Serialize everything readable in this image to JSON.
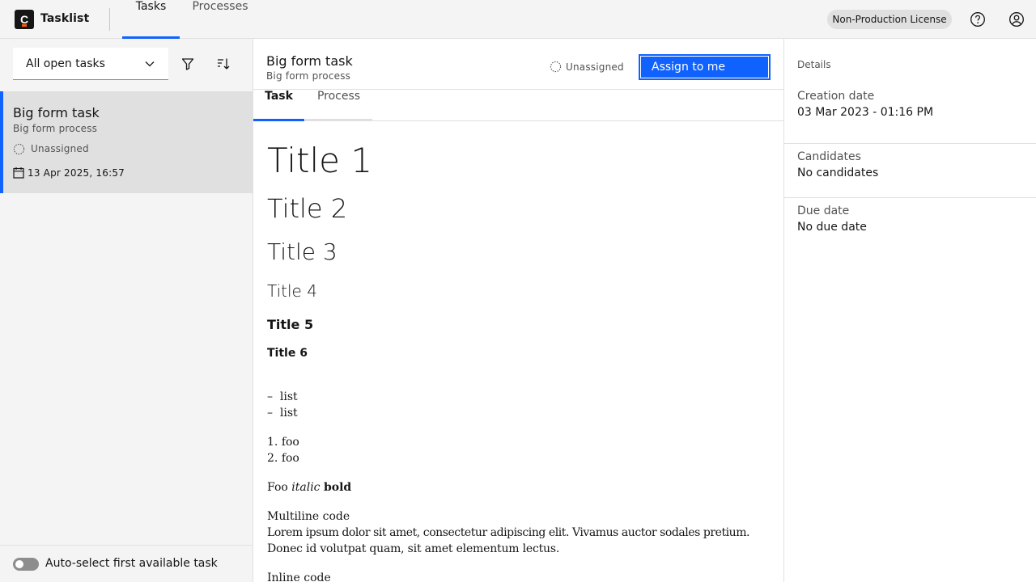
{
  "header": {
    "app_name": "Tasklist",
    "logo_letter": "C",
    "nav": {
      "tasks": "Tasks",
      "processes": "Processes"
    },
    "license": "Non-Production License"
  },
  "sidebar": {
    "filter_value": "All open tasks",
    "task": {
      "name": "Big form task",
      "process": "Big form process",
      "assignee": "Unassigned",
      "date": "13 Apr 2025, 16:57"
    },
    "auto_select_label": "Auto-select first available task"
  },
  "task_view": {
    "title": "Big form task",
    "subtitle": "Big form process",
    "assignee": "Unassigned",
    "assign_button": "Assign to me",
    "tabs": {
      "task": "Task",
      "process": "Process"
    },
    "content": {
      "h1": "Title 1",
      "h2": "Title 2",
      "h3": "Title 3",
      "h4": "Title 4",
      "h5": "Title 5",
      "h6": "Title 6",
      "bullets": [
        "list",
        "list"
      ],
      "numbered": [
        "foo",
        "foo"
      ],
      "foo": "Foo",
      "italic": "italic",
      "bold": "bold",
      "multiline_label": "Multiline code",
      "lorem_1": "Lorem ipsum dolor sit amet, consectetur adipiscing elit. Vivamus auctor sodales pretium.",
      "lorem_2": "Donec id volutpat quam, sit amet elementum lectus.",
      "inline_code": "Inline code"
    }
  },
  "details": {
    "title": "Details",
    "creation_label": "Creation date",
    "creation_value": "03 Mar 2023 - 01:16 PM",
    "candidates_label": "Candidates",
    "candidates_value": "No candidates",
    "due_label": "Due date",
    "due_value": "No due date"
  }
}
